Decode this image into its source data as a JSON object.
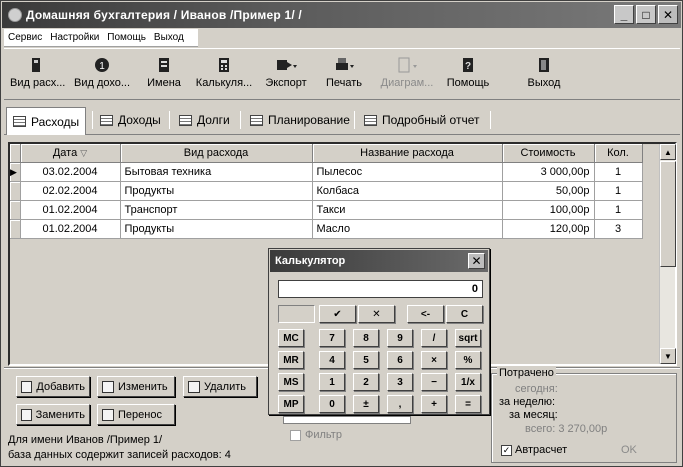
{
  "window": {
    "title": "Домашняя бухгалтерия   / Иванов /Пример 1/ /",
    "controls": {
      "minimize": "_",
      "maximize": "□",
      "close": "✕"
    }
  },
  "menu": [
    "Сервис",
    "Настройки",
    "Помощь",
    "Выход"
  ],
  "toolbar": [
    {
      "label": "Вид расх...",
      "icon": "expense-view-icon"
    },
    {
      "label": "Вид дохо...",
      "icon": "income-view-icon"
    },
    {
      "label": "Имена",
      "icon": "names-icon"
    },
    {
      "label": "Калькуля...",
      "icon": "calculator-icon"
    },
    {
      "label": "Экспорт",
      "icon": "export-icon"
    },
    {
      "label": "Печать",
      "icon": "print-icon"
    },
    {
      "label": "Диаграм...",
      "icon": "chart-icon"
    },
    {
      "label": "Помощь",
      "icon": "help-icon"
    },
    {
      "label": "Выход",
      "icon": "exit-icon"
    }
  ],
  "tabs": [
    "Расходы",
    "Доходы",
    "Долги",
    "Планирование",
    "Подробный отчет"
  ],
  "table": {
    "columns": [
      "Дата",
      "Вид расхода",
      "Название расхода",
      "Стоимость",
      "Кол."
    ],
    "rows": [
      [
        "03.02.2004",
        "Бытовая техника",
        "Пылесос",
        "3 000,00р",
        "1"
      ],
      [
        "02.02.2004",
        "Продукты",
        "Колбаса",
        "50,00р",
        "1"
      ],
      [
        "01.02.2004",
        "Транспорт",
        "Такси",
        "100,00р",
        "1"
      ],
      [
        "01.02.2004",
        "Продукты",
        "Масло",
        "120,00р",
        "3"
      ]
    ]
  },
  "buttons": {
    "add": "Добавить",
    "edit": "Изменить",
    "delete": "Удалить",
    "replace": "Заменить",
    "transfer": "Перенос"
  },
  "status": {
    "line1": "Для имени Иванов /Пример 1/",
    "line2": "база данных содержит записей расходов: 4"
  },
  "filter": {
    "label": "Фильтр"
  },
  "spent": {
    "title": "Потрачено",
    "today": "сегодня:",
    "week": "за неделю:",
    "month": "за месяц:",
    "total": "всего: 3 270,00р",
    "autocalc": "Автрасчет",
    "ok": "OK"
  },
  "calculator": {
    "title": "Калькулятор",
    "display": "0",
    "keys": {
      "ok": "✔",
      "cancel": "✕",
      "back": "<-",
      "clear": "C",
      "mc": "MC",
      "mr": "MR",
      "ms": "MS",
      "mp": "MP",
      "k7": "7",
      "k8": "8",
      "k9": "9",
      "div": "/",
      "sqrt": "sqrt",
      "k4": "4",
      "k5": "5",
      "k6": "6",
      "mul": "×",
      "pct": "%",
      "k1": "1",
      "k2": "2",
      "k3": "3",
      "sub": "−",
      "inv": "1/x",
      "k0": "0",
      "sign": "±",
      "dot": ",",
      "add": "+",
      "eq": "="
    }
  }
}
